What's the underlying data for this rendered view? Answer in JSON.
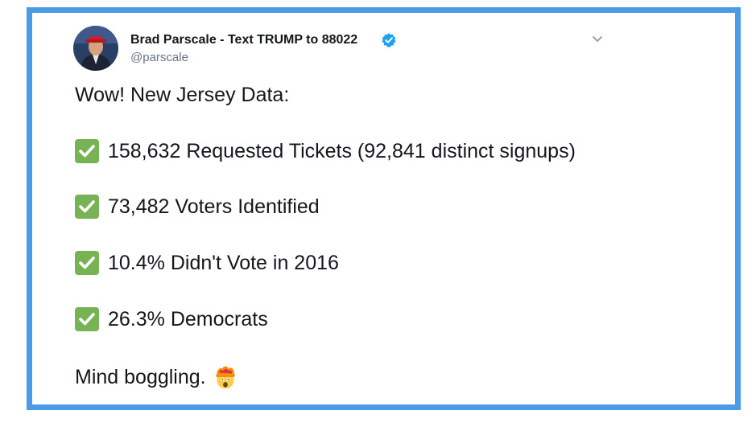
{
  "tweet": {
    "author": {
      "display_name": "Brad Parscale - Text TRUMP to 88022",
      "handle": "@parscale",
      "verified": true,
      "avatar_icon": "profile-photo-icon"
    },
    "menu_icon": "chevron-down-icon",
    "intro": "Wow! New Jersey Data:",
    "items": [
      {
        "icon": "check-mark-button-icon",
        "text": "158,632 Requested Tickets (92,841 distinct signups)"
      },
      {
        "icon": "check-mark-button-icon",
        "text": "73,482 Voters Identified"
      },
      {
        "icon": "check-mark-button-icon",
        "text": "10.4% Didn't Vote in 2016"
      },
      {
        "icon": "check-mark-button-icon",
        "text": "26.3% Democrats"
      }
    ],
    "closing": "Mind boggling.",
    "closing_emoji": "exploding-head-icon"
  },
  "colors": {
    "frame_border": "#4c9be6",
    "verified_badge": "#1da1f2",
    "check_green": "#77b255",
    "text": "#14171a",
    "handle_gray": "#657786"
  }
}
